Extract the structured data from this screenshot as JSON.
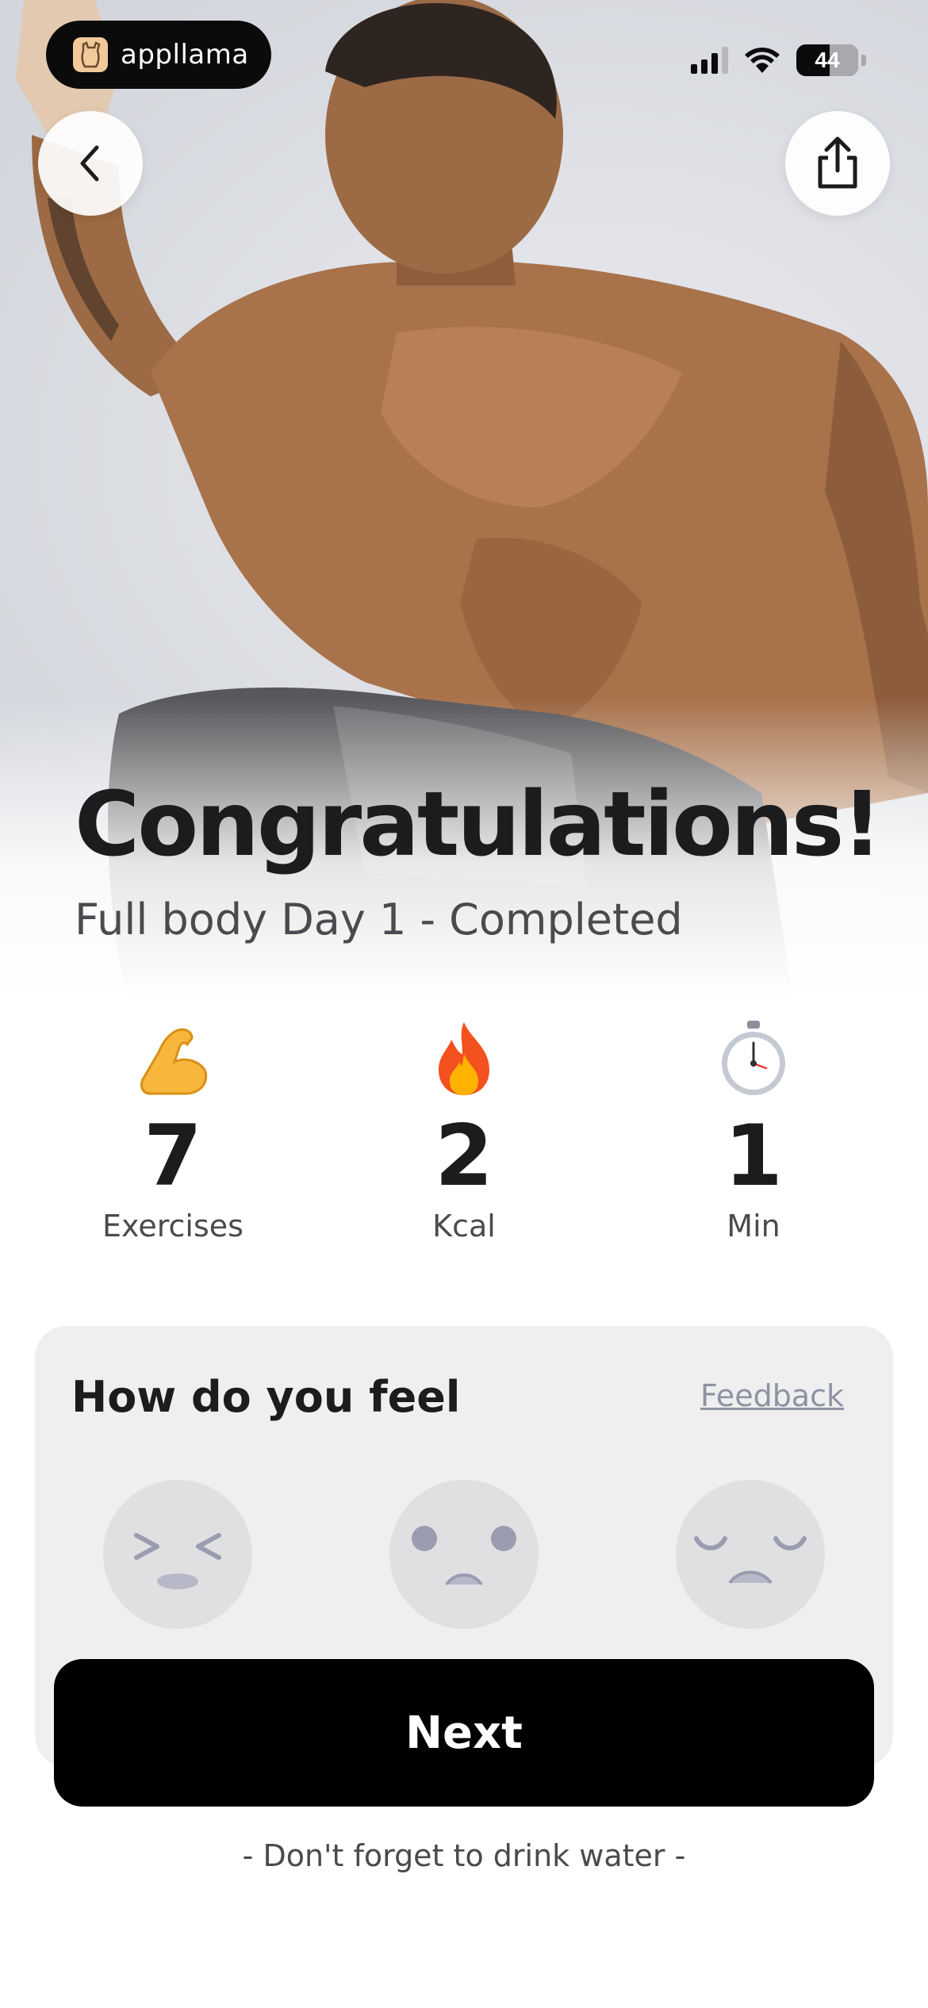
{
  "status_bar": {
    "recorder_brand": "appllama",
    "battery_level": "44"
  },
  "header": {
    "back_icon": "chevron-left-icon",
    "share_icon": "share-icon"
  },
  "hero": {
    "title": "Congratulations!",
    "subtitle": "Full body Day 1 - Completed"
  },
  "stats": [
    {
      "icon": "flexed-biceps-icon",
      "value": "7",
      "label": "Exercises"
    },
    {
      "icon": "fire-icon",
      "value": "2",
      "label": "Kcal"
    },
    {
      "icon": "stopwatch-icon",
      "value": "1",
      "label": "Min"
    }
  ],
  "feel": {
    "heading": "How do you feel",
    "feedback_link": "Feedback",
    "options": [
      {
        "icon": "exhausted-face-icon",
        "label": ""
      },
      {
        "icon": "sad-face-icon",
        "label": ""
      },
      {
        "icon": "tired-face-icon",
        "label": ""
      }
    ]
  },
  "actions": {
    "next_label": "Next",
    "hint": "- Don't forget to drink water -"
  },
  "colors": {
    "button": "#000000",
    "card_bg": "#efefef",
    "face_bg": "#e0e0e2",
    "feedback": "#8d93a3"
  }
}
